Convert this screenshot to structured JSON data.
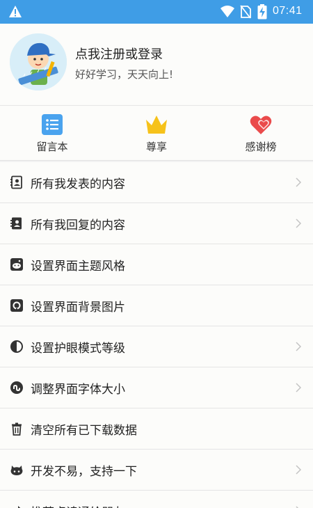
{
  "status_bar": {
    "time": "07:41",
    "icons": [
      "warning-icon",
      "wifi-icon",
      "no-sim-icon",
      "battery-charging-icon"
    ]
  },
  "profile": {
    "title": "点我注册或登录",
    "subtitle": "好好学习，天天向上!"
  },
  "shortcuts": [
    {
      "label": "留言本",
      "icon": "list-icon",
      "color": "#4aa3ee"
    },
    {
      "label": "尊享",
      "icon": "crown-icon",
      "color": "#f6c21a"
    },
    {
      "label": "感谢榜",
      "icon": "hearts-icon",
      "color": "#ea4b4b"
    }
  ],
  "menu": [
    {
      "label": "所有我发表的内容",
      "icon": "contact-card-icon",
      "has_arrow": true
    },
    {
      "label": "所有我回复的内容",
      "icon": "address-book-icon",
      "has_arrow": true
    },
    {
      "label": "设置界面主题风格",
      "icon": "reddit-icon",
      "has_arrow": false
    },
    {
      "label": "设置界面背景图片",
      "icon": "github-icon",
      "has_arrow": false
    },
    {
      "label": "设置护眼模式等级",
      "icon": "contrast-icon",
      "has_arrow": true
    },
    {
      "label": "调整界面字体大小",
      "icon": "stumbleupon-icon",
      "has_arrow": true
    },
    {
      "label": "清空所有已下载数据",
      "icon": "trash-icon",
      "has_arrow": false
    },
    {
      "label": "开发不易，支持一下",
      "icon": "github-alt-icon",
      "has_arrow": true
    },
    {
      "label": "推荐卓读通给朋友",
      "icon": "share-icon",
      "has_arrow": true
    }
  ],
  "colors": {
    "status_bar": "#3f9de6",
    "background": "#fcfcfa",
    "divider": "#e4e4e4"
  }
}
